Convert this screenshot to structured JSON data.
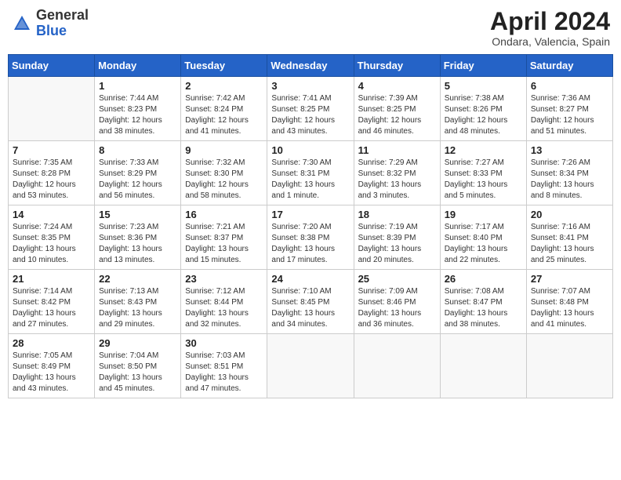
{
  "header": {
    "logo_general": "General",
    "logo_blue": "Blue",
    "month_year": "April 2024",
    "location": "Ondara, Valencia, Spain"
  },
  "columns": [
    "Sunday",
    "Monday",
    "Tuesday",
    "Wednesday",
    "Thursday",
    "Friday",
    "Saturday"
  ],
  "weeks": [
    [
      {
        "day": "",
        "sunrise": "",
        "sunset": "",
        "daylight": ""
      },
      {
        "day": "1",
        "sunrise": "Sunrise: 7:44 AM",
        "sunset": "Sunset: 8:23 PM",
        "daylight": "Daylight: 12 hours and 38 minutes."
      },
      {
        "day": "2",
        "sunrise": "Sunrise: 7:42 AM",
        "sunset": "Sunset: 8:24 PM",
        "daylight": "Daylight: 12 hours and 41 minutes."
      },
      {
        "day": "3",
        "sunrise": "Sunrise: 7:41 AM",
        "sunset": "Sunset: 8:25 PM",
        "daylight": "Daylight: 12 hours and 43 minutes."
      },
      {
        "day": "4",
        "sunrise": "Sunrise: 7:39 AM",
        "sunset": "Sunset: 8:25 PM",
        "daylight": "Daylight: 12 hours and 46 minutes."
      },
      {
        "day": "5",
        "sunrise": "Sunrise: 7:38 AM",
        "sunset": "Sunset: 8:26 PM",
        "daylight": "Daylight: 12 hours and 48 minutes."
      },
      {
        "day": "6",
        "sunrise": "Sunrise: 7:36 AM",
        "sunset": "Sunset: 8:27 PM",
        "daylight": "Daylight: 12 hours and 51 minutes."
      }
    ],
    [
      {
        "day": "7",
        "sunrise": "Sunrise: 7:35 AM",
        "sunset": "Sunset: 8:28 PM",
        "daylight": "Daylight: 12 hours and 53 minutes."
      },
      {
        "day": "8",
        "sunrise": "Sunrise: 7:33 AM",
        "sunset": "Sunset: 8:29 PM",
        "daylight": "Daylight: 12 hours and 56 minutes."
      },
      {
        "day": "9",
        "sunrise": "Sunrise: 7:32 AM",
        "sunset": "Sunset: 8:30 PM",
        "daylight": "Daylight: 12 hours and 58 minutes."
      },
      {
        "day": "10",
        "sunrise": "Sunrise: 7:30 AM",
        "sunset": "Sunset: 8:31 PM",
        "daylight": "Daylight: 13 hours and 1 minute."
      },
      {
        "day": "11",
        "sunrise": "Sunrise: 7:29 AM",
        "sunset": "Sunset: 8:32 PM",
        "daylight": "Daylight: 13 hours and 3 minutes."
      },
      {
        "day": "12",
        "sunrise": "Sunrise: 7:27 AM",
        "sunset": "Sunset: 8:33 PM",
        "daylight": "Daylight: 13 hours and 5 minutes."
      },
      {
        "day": "13",
        "sunrise": "Sunrise: 7:26 AM",
        "sunset": "Sunset: 8:34 PM",
        "daylight": "Daylight: 13 hours and 8 minutes."
      }
    ],
    [
      {
        "day": "14",
        "sunrise": "Sunrise: 7:24 AM",
        "sunset": "Sunset: 8:35 PM",
        "daylight": "Daylight: 13 hours and 10 minutes."
      },
      {
        "day": "15",
        "sunrise": "Sunrise: 7:23 AM",
        "sunset": "Sunset: 8:36 PM",
        "daylight": "Daylight: 13 hours and 13 minutes."
      },
      {
        "day": "16",
        "sunrise": "Sunrise: 7:21 AM",
        "sunset": "Sunset: 8:37 PM",
        "daylight": "Daylight: 13 hours and 15 minutes."
      },
      {
        "day": "17",
        "sunrise": "Sunrise: 7:20 AM",
        "sunset": "Sunset: 8:38 PM",
        "daylight": "Daylight: 13 hours and 17 minutes."
      },
      {
        "day": "18",
        "sunrise": "Sunrise: 7:19 AM",
        "sunset": "Sunset: 8:39 PM",
        "daylight": "Daylight: 13 hours and 20 minutes."
      },
      {
        "day": "19",
        "sunrise": "Sunrise: 7:17 AM",
        "sunset": "Sunset: 8:40 PM",
        "daylight": "Daylight: 13 hours and 22 minutes."
      },
      {
        "day": "20",
        "sunrise": "Sunrise: 7:16 AM",
        "sunset": "Sunset: 8:41 PM",
        "daylight": "Daylight: 13 hours and 25 minutes."
      }
    ],
    [
      {
        "day": "21",
        "sunrise": "Sunrise: 7:14 AM",
        "sunset": "Sunset: 8:42 PM",
        "daylight": "Daylight: 13 hours and 27 minutes."
      },
      {
        "day": "22",
        "sunrise": "Sunrise: 7:13 AM",
        "sunset": "Sunset: 8:43 PM",
        "daylight": "Daylight: 13 hours and 29 minutes."
      },
      {
        "day": "23",
        "sunrise": "Sunrise: 7:12 AM",
        "sunset": "Sunset: 8:44 PM",
        "daylight": "Daylight: 13 hours and 32 minutes."
      },
      {
        "day": "24",
        "sunrise": "Sunrise: 7:10 AM",
        "sunset": "Sunset: 8:45 PM",
        "daylight": "Daylight: 13 hours and 34 minutes."
      },
      {
        "day": "25",
        "sunrise": "Sunrise: 7:09 AM",
        "sunset": "Sunset: 8:46 PM",
        "daylight": "Daylight: 13 hours and 36 minutes."
      },
      {
        "day": "26",
        "sunrise": "Sunrise: 7:08 AM",
        "sunset": "Sunset: 8:47 PM",
        "daylight": "Daylight: 13 hours and 38 minutes."
      },
      {
        "day": "27",
        "sunrise": "Sunrise: 7:07 AM",
        "sunset": "Sunset: 8:48 PM",
        "daylight": "Daylight: 13 hours and 41 minutes."
      }
    ],
    [
      {
        "day": "28",
        "sunrise": "Sunrise: 7:05 AM",
        "sunset": "Sunset: 8:49 PM",
        "daylight": "Daylight: 13 hours and 43 minutes."
      },
      {
        "day": "29",
        "sunrise": "Sunrise: 7:04 AM",
        "sunset": "Sunset: 8:50 PM",
        "daylight": "Daylight: 13 hours and 45 minutes."
      },
      {
        "day": "30",
        "sunrise": "Sunrise: 7:03 AM",
        "sunset": "Sunset: 8:51 PM",
        "daylight": "Daylight: 13 hours and 47 minutes."
      },
      {
        "day": "",
        "sunrise": "",
        "sunset": "",
        "daylight": ""
      },
      {
        "day": "",
        "sunrise": "",
        "sunset": "",
        "daylight": ""
      },
      {
        "day": "",
        "sunrise": "",
        "sunset": "",
        "daylight": ""
      },
      {
        "day": "",
        "sunrise": "",
        "sunset": "",
        "daylight": ""
      }
    ]
  ]
}
